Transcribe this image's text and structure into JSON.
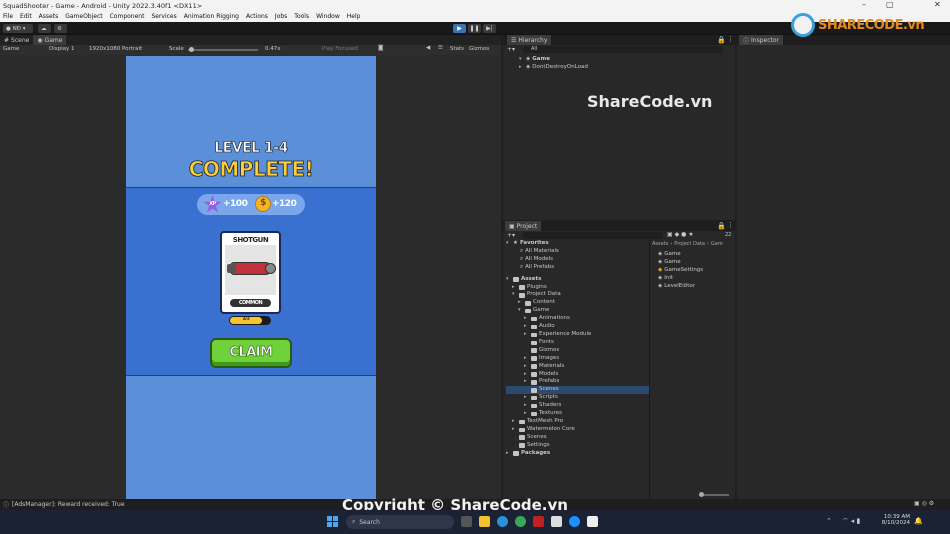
{
  "window": {
    "title": "SquadShooter - Game - Android - Unity 2022.3.40f1 <DX11>"
  },
  "menu": [
    "File",
    "Edit",
    "Assets",
    "GameObject",
    "Component",
    "Services",
    "Animation Rigging",
    "Actions",
    "Jobs",
    "Tools",
    "Window",
    "Help"
  ],
  "toolbar": {
    "account": "NĐ"
  },
  "game_tabs": [
    "Scene",
    "Game"
  ],
  "game_bar": {
    "mode": "Game",
    "display": "Display 1",
    "resolution": "1920x1080 Portrait",
    "scale_label": "Scale",
    "scale_value": "0.47x",
    "play_focused": "Play Focused",
    "stats": "Stats",
    "gizmos": "Gizmos"
  },
  "game": {
    "level": "LEVEL 1-4",
    "complete": "COMPLETE!",
    "xp_badge": "XP",
    "xp": "+100",
    "coin_symbol": "$",
    "coins": "+120",
    "card_name": "SHOTGUN",
    "card_rarity": "COMMON",
    "card_progress": "4/3",
    "claim": "CLAIM"
  },
  "hierarchy": {
    "tab": "Hierarchy",
    "search": "All",
    "items": [
      "Game",
      "DontDestroyOnLoad"
    ]
  },
  "inspector": {
    "tab": "Inspector"
  },
  "watermark": {
    "logo": "SHARECODE.vn",
    "center": "ShareCode.vn",
    "copyright": "Copyright © ShareCode.vn"
  },
  "project": {
    "tab": "Project",
    "count": "22",
    "favorites_label": "Favorites",
    "favorites": [
      "All Materials",
      "All Models",
      "All Prefabs"
    ],
    "assets_label": "Assets",
    "tree1": [
      "Plugins",
      "Project Data"
    ],
    "tree2": [
      "Content",
      "Game"
    ],
    "game_children": [
      "Animations",
      "Audio",
      "Experience Module",
      "Fonts",
      "Gizmos",
      "Images",
      "Materials",
      "Models",
      "Prefabs",
      "Scenes",
      "Scripts",
      "Shaders",
      "Textures"
    ],
    "tree3": [
      "TextMesh Pro",
      "Watermelon Core"
    ],
    "tree4": [
      "Scenes",
      "Settings"
    ],
    "packages_label": "Packages",
    "breadcrumb": [
      "Assets",
      "Project Data",
      "Gam"
    ],
    "files": [
      "Game",
      "Game",
      "GameSettings",
      "Init",
      "LevelEditor"
    ]
  },
  "status": {
    "message": "[AdsManager]: Reward received: True"
  },
  "taskbar": {
    "search": "Search",
    "time": "10:39 AM",
    "date": "8/10/2024"
  }
}
